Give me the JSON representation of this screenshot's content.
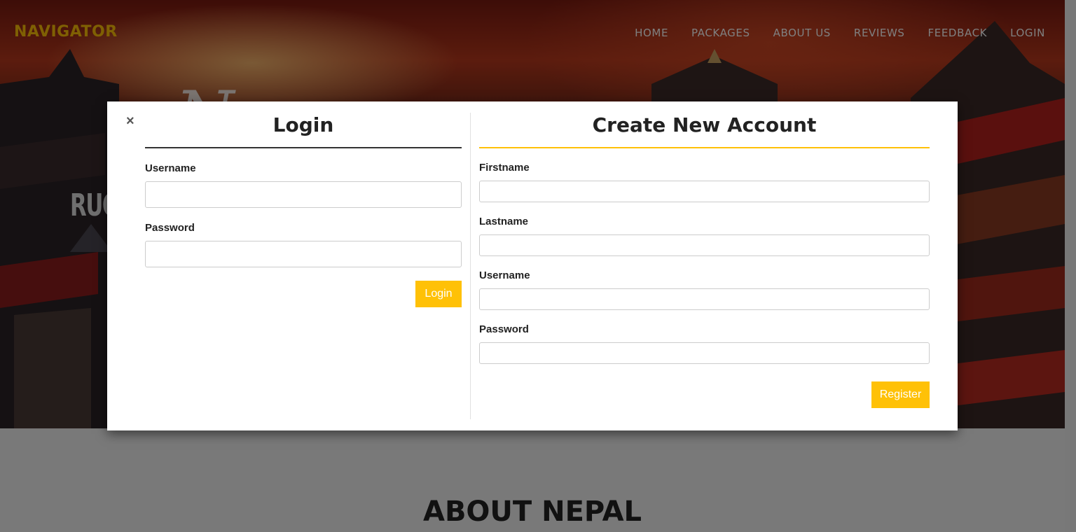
{
  "brand": "NAVIGATOR",
  "nav": {
    "items": [
      "HOME",
      "PACKAGES",
      "ABOUT US",
      "REVIEWS",
      "FEEDBACK",
      "LOGIN"
    ]
  },
  "hero": {
    "visible_text": "RUG"
  },
  "about": {
    "title": "ABOUT NEPAL"
  },
  "modal": {
    "close_glyph": "×",
    "login": {
      "title": "Login",
      "username_label": "Username",
      "username_value": "",
      "password_label": "Password",
      "password_value": "",
      "submit_label": "Login"
    },
    "register": {
      "title": "Create New Account",
      "firstname_label": "Firstname",
      "lastname_label": "Lastname",
      "username_label": "Username",
      "password_label": "Password",
      "submit_label": "Register"
    }
  },
  "colors": {
    "accent": "#ffc107",
    "text_dark": "#222222"
  }
}
